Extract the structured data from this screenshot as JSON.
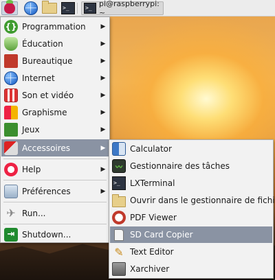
{
  "taskbar": {
    "menu_icon": "raspberry-pi-icon",
    "launchers": [
      "globe-icon",
      "folder-icon",
      "terminal-icon"
    ],
    "window_title": "pi@raspberrypi: ~",
    "window_icon_text": ">_"
  },
  "menu": {
    "items": [
      {
        "label": "Programmation",
        "icon": "programming-icon",
        "submenu": true
      },
      {
        "label": "Éducation",
        "icon": "education-icon",
        "submenu": true
      },
      {
        "label": "Bureautique",
        "icon": "office-icon",
        "submenu": true
      },
      {
        "label": "Internet",
        "icon": "internet-icon",
        "submenu": true
      },
      {
        "label": "Son et vidéo",
        "icon": "sound-video-icon",
        "submenu": true
      },
      {
        "label": "Graphisme",
        "icon": "graphics-icon",
        "submenu": true
      },
      {
        "label": "Jeux",
        "icon": "games-icon",
        "submenu": true
      },
      {
        "label": "Accessoires",
        "icon": "accessories-icon",
        "submenu": true,
        "active": true
      },
      {
        "label": "Help",
        "icon": "help-icon",
        "submenu": true
      },
      {
        "label": "Préférences",
        "icon": "preferences-icon",
        "submenu": true
      },
      {
        "label": "Run...",
        "icon": "run-icon",
        "submenu": false
      },
      {
        "label": "Shutdown...",
        "icon": "shutdown-icon",
        "submenu": false
      }
    ]
  },
  "submenu": {
    "items": [
      {
        "label": "Calculator",
        "icon": "calculator-icon"
      },
      {
        "label": "Gestionnaire des tâches",
        "icon": "task-manager-icon"
      },
      {
        "label": "LXTerminal",
        "icon": "terminal-icon",
        "icon_text": ">_"
      },
      {
        "label": "Ouvrir dans le gestionnaire de fichiers",
        "icon": "folder-icon"
      },
      {
        "label": "PDF Viewer",
        "icon": "pdf-viewer-icon"
      },
      {
        "label": "SD Card Copier",
        "icon": "sd-card-icon",
        "active": true
      },
      {
        "label": "Text Editor",
        "icon": "text-editor-icon"
      },
      {
        "label": "Xarchiver",
        "icon": "archive-icon"
      }
    ]
  },
  "colors": {
    "menu_bg": "#f2f2f2",
    "highlight": "#8a93a3",
    "taskbar_bg": "#ececec"
  },
  "arrow_glyph": "▶"
}
